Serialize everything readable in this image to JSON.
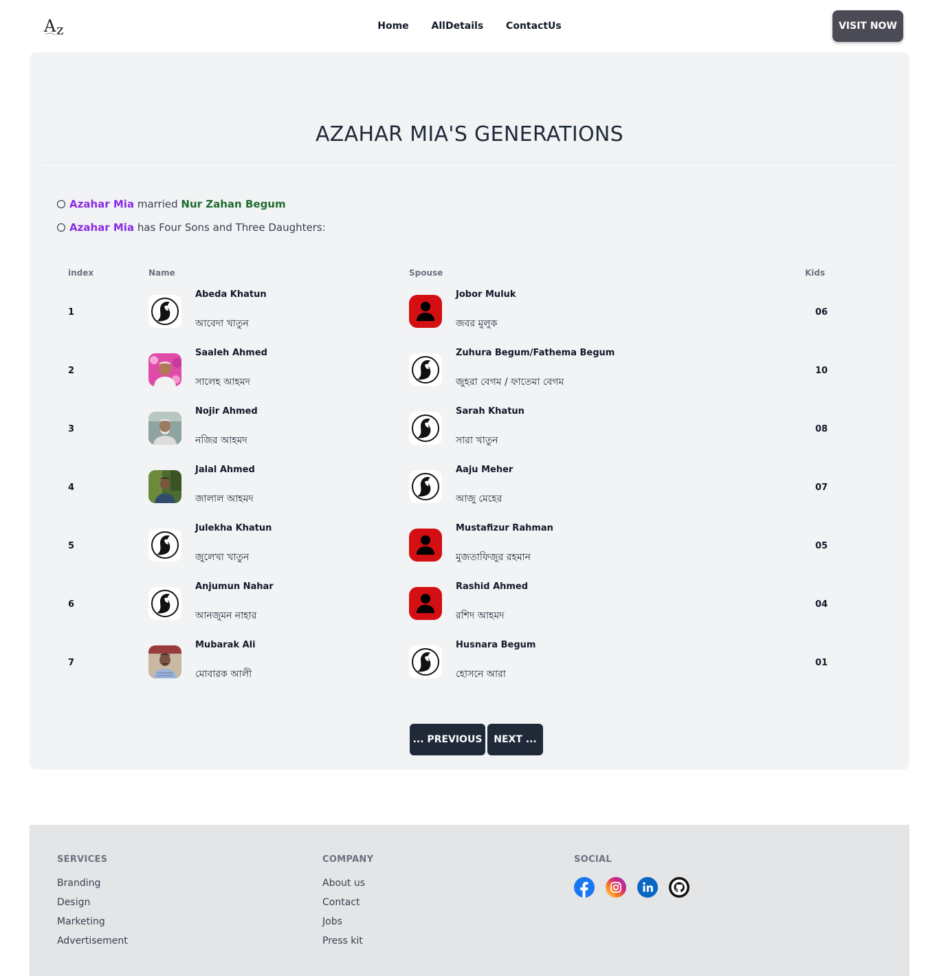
{
  "header": {
    "logo_text": "Az",
    "nav": [
      "Home",
      "AllDetails",
      "ContactUs"
    ],
    "cta_label": "VISIT NOW"
  },
  "page": {
    "title": "AZAHAR MIA'S GENERATIONS",
    "facts": [
      {
        "subject": "Azahar Mia",
        "verb": " married ",
        "object": "Nur Zahan Begum",
        "tail": ""
      },
      {
        "subject": "Azahar Mia",
        "verb": " has Four Sons and Three Daughters:",
        "object": "",
        "tail": ""
      }
    ],
    "columns": [
      "index",
      "Name",
      "Spouse",
      "Kids"
    ],
    "rows": [
      {
        "index": "1",
        "name_en": "Abeda Khatun",
        "name_bn": "আবেদা খাতুন",
        "name_avatar": "hijab-avatar-icon",
        "spouse_en": "Jobor Muluk",
        "spouse_bn": "জবর মুলুক",
        "spouse_avatar": "person-silhouette-icon",
        "kids": "06"
      },
      {
        "index": "2",
        "name_en": "Saaleh Ahmed",
        "name_bn": "সালেহ আহমদ",
        "name_avatar": "photo-pink",
        "spouse_en": "Zuhura Begum/Fathema Begum",
        "spouse_bn": "জুহরা বেগম / ফাতেমা বেগম",
        "spouse_avatar": "hijab-avatar-icon",
        "kids": "10"
      },
      {
        "index": "3",
        "name_en": "Nojir Ahmed",
        "name_bn": "নজির আহমদ",
        "name_avatar": "photo-grey",
        "spouse_en": "Sarah Khatun",
        "spouse_bn": "সারা খাতুন",
        "spouse_avatar": "hijab-avatar-icon",
        "kids": "08"
      },
      {
        "index": "4",
        "name_en": "Jalal Ahmed",
        "name_bn": "জালাল আহমদ",
        "name_avatar": "photo-green",
        "spouse_en": "Aaju Meher",
        "spouse_bn": "আজু মেহের",
        "spouse_avatar": "hijab-avatar-icon",
        "kids": "07"
      },
      {
        "index": "5",
        "name_en": "Julekha Khatun",
        "name_bn": "জুলেখা খাতুন",
        "name_avatar": "hijab-avatar-icon",
        "spouse_en": "Mustafizur Rahman",
        "spouse_bn": "মুজতাফিজুর রহমান",
        "spouse_avatar": "person-silhouette-icon",
        "kids": "05"
      },
      {
        "index": "6",
        "name_en": "Anjumun Nahar",
        "name_bn": "আনজুমন নাহার",
        "name_avatar": "hijab-avatar-icon",
        "spouse_en": "Rashid Ahmed",
        "spouse_bn": "রশিদ আহমদ",
        "spouse_avatar": "person-silhouette-icon",
        "kids": "04"
      },
      {
        "index": "7",
        "name_en": "Mubarak Ali",
        "name_bn": "মোবারক আলী",
        "name_avatar": "photo-blue",
        "spouse_en": "Husnara Begum",
        "spouse_bn": "হোসনে আরা",
        "spouse_avatar": "hijab-avatar-icon",
        "kids": "01"
      }
    ],
    "pagination": {
      "prev_label": "... PREVIOUS",
      "next_label": "NEXT ..."
    }
  },
  "footer": {
    "services": {
      "heading": "SERVICES",
      "links": [
        "Branding",
        "Design",
        "Marketing",
        "Advertisement"
      ]
    },
    "company": {
      "heading": "COMPANY",
      "links": [
        "About us",
        "Contact",
        "Jobs",
        "Press kit"
      ]
    },
    "social": {
      "heading": "SOCIAL",
      "icons": [
        "facebook-icon",
        "instagram-icon",
        "linkedin-icon",
        "github-icon"
      ]
    }
  },
  "colors": {
    "accent_purple": "#8a2be2",
    "accent_green": "#1f6b2e",
    "button_dark": "#1f2937",
    "cta_grey": "#4b4b55",
    "card_bg": "#f2f3f5",
    "footer_bg": "#e4e5e6",
    "male_avatar_red": "#d40f14"
  }
}
